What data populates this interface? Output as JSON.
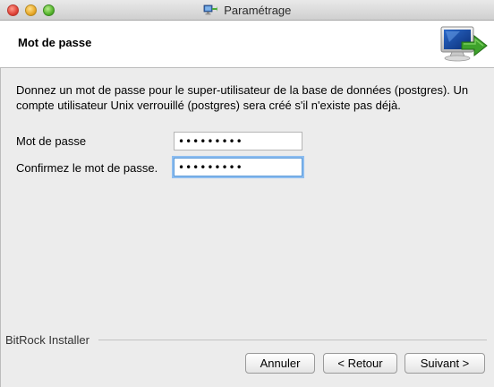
{
  "window": {
    "title": "Paramétrage",
    "title_icon": "installer-icon"
  },
  "header": {
    "title": "Mot de passe",
    "icon": "computer-arrow-icon"
  },
  "content": {
    "description": "Donnez un mot de passe pour le super-utilisateur de la base de données (postgres). Un compte utilisateur Unix verrouillé (postgres) sera créé s'il n'existe pas déjà.",
    "password_label": "Mot de passe",
    "password_value": "•••••••••",
    "confirm_label": "Confirmez le mot de passe.",
    "confirm_value": "•••••••••"
  },
  "footer": {
    "brand": "BitRock Installer",
    "cancel_label": "Annuler",
    "back_label": "< Retour",
    "next_label": "Suivant >"
  }
}
